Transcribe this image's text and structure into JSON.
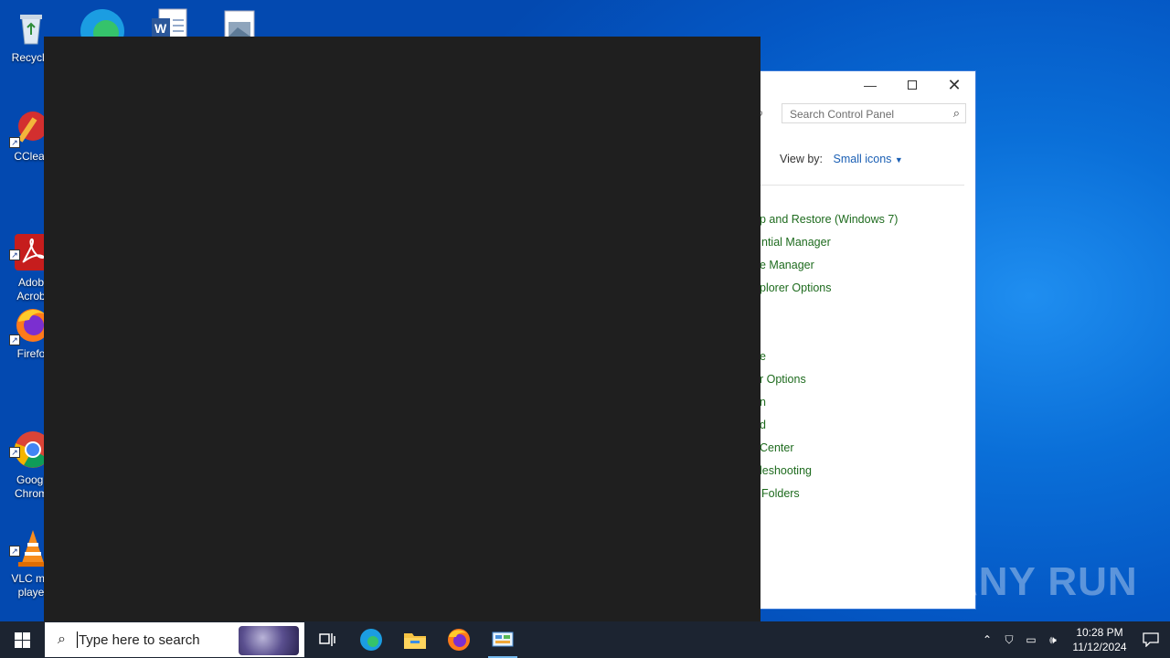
{
  "desktop": {
    "icons": [
      {
        "label": "Recycle",
        "icon": "recycle-bin-icon"
      },
      {
        "label": "CClear",
        "icon": "ccleaner-icon"
      },
      {
        "label": "Adob\nAcrob",
        "icon": "adobe-acrobat-icon"
      },
      {
        "label": "Firefo",
        "icon": "firefox-icon"
      },
      {
        "label": "Googl\nChrom",
        "icon": "chrome-icon"
      },
      {
        "label": "VLC me\nplaye",
        "icon": "vlc-icon"
      }
    ],
    "top_icons": [
      "edge-icon",
      "word-document-icon",
      "image-file-icon"
    ]
  },
  "control_panel": {
    "search_placeholder": "Search Control Panel",
    "view_by_label": "View by:",
    "view_by_value": "Small icons",
    "items": [
      "p and Restore (Windows 7)",
      "ntial Manager",
      "e Manager",
      "plorer Options",
      "e",
      "r Options",
      "n",
      "d",
      "Center",
      "leshooting",
      "Folders"
    ],
    "item_color": "#1e6b1e"
  },
  "watermark": "ANY RUN",
  "taskbar": {
    "search_placeholder": "Type here to search",
    "clock_time": "10:28 PM",
    "clock_date": "11/12/2024",
    "pinned": [
      "task-view-icon",
      "edge-icon",
      "file-explorer-icon",
      "firefox-icon",
      "control-panel-icon"
    ]
  }
}
